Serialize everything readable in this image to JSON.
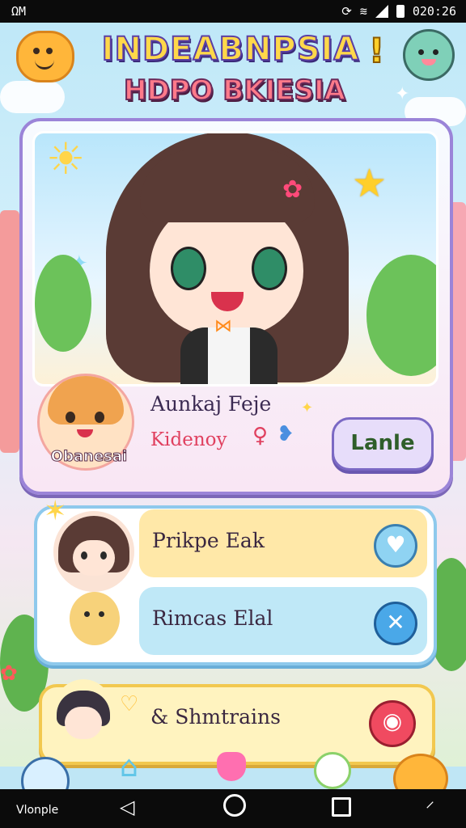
{
  "status_bar": {
    "left_text": "ΩM",
    "time": "020:26"
  },
  "header": {
    "title_line1": "INDEABNPSIA",
    "title_line2": "HDPO BKIESIA",
    "exclaim": "!"
  },
  "profile": {
    "player_name": "Aunkaj Feje",
    "player_subtitle": "Kidenoy",
    "avatar_label": "Obanesai",
    "action_button": "Lanle"
  },
  "list": {
    "items": [
      {
        "label": "Prikpe Eak",
        "icon": "heart-chat-icon"
      },
      {
        "label": "Rimcas Elal",
        "icon": "close-icon"
      },
      {
        "label": "& Shmtrains",
        "icon": "face-icon"
      }
    ]
  },
  "bottom_nav": {
    "home_label": "Vlonple"
  },
  "colors": {
    "accent_purple": "#9b84d8",
    "row_yellow": "#ffe8a8",
    "row_blue": "#bfe8f7",
    "red_button": "#f04a60"
  }
}
